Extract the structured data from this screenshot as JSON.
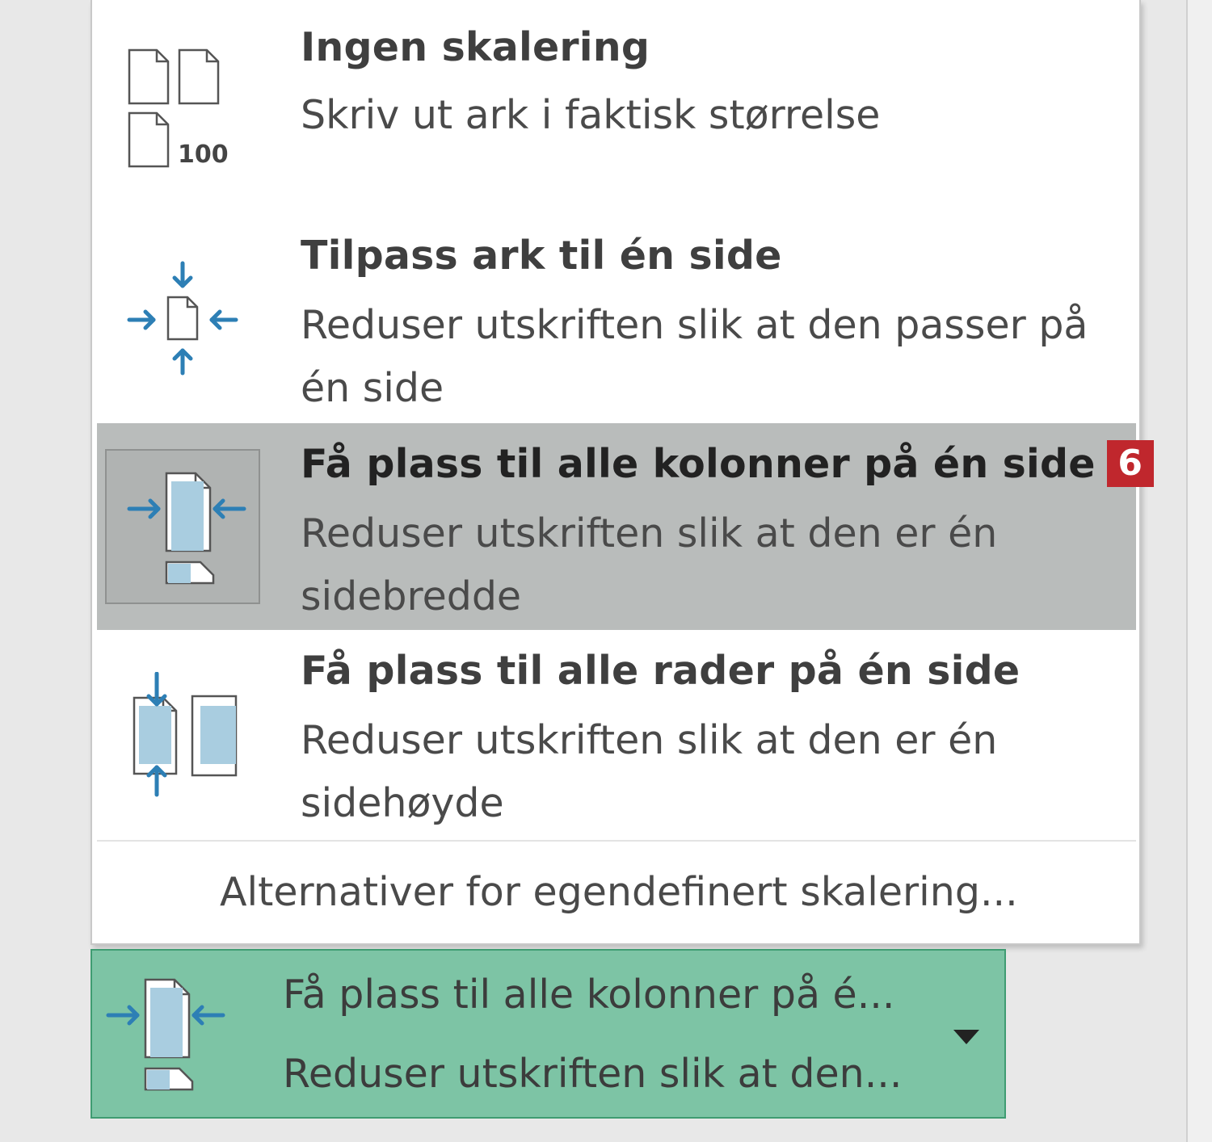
{
  "menu": {
    "options": [
      {
        "title": "Ingen skalering",
        "description": "Skriv ut ark i faktisk størrelse",
        "icon": "no-scaling-icon",
        "icon_label": "100"
      },
      {
        "title": "Tilpass ark til én side",
        "description": "Reduser utskriften slik at den passer på én side",
        "icon": "fit-sheet-on-one-page-icon"
      },
      {
        "title": "Få plass til alle kolonner på én side",
        "description": "Reduser utskriften slik at den er én sidebredde",
        "icon": "fit-all-columns-icon",
        "badge": "6",
        "selected": true
      },
      {
        "title": "Få plass til alle rader på én side",
        "description": "Reduser utskriften slik at den er én sidehøyde",
        "icon": "fit-all-rows-icon"
      }
    ],
    "custom_scaling_label": "Alternativer for egendefinert skalering..."
  },
  "dropdown": {
    "line1": "Få plass til alle kolonner på é...",
    "line2": "Reduser utskriften slik at den...",
    "icon": "fit-all-columns-icon"
  },
  "colors": {
    "accent_blue": "#2d7fb5",
    "page_fill_blue": "#a9cde0",
    "selected_bg": "#b9bcbb",
    "dropdown_bg": "#7dc4a5",
    "badge_red": "#c0272d"
  }
}
